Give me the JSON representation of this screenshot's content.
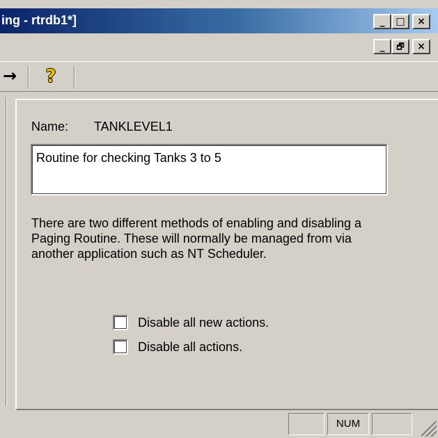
{
  "window": {
    "title": "ing - rtrdb1*]",
    "minimize_glyph": "_",
    "maximize_glyph": "□",
    "close_glyph": "×",
    "restore_glyph": "🗗"
  },
  "toolbar": {
    "arrow_icon": "→",
    "help_icon": "?"
  },
  "form": {
    "name_label": "Name:",
    "name_value": "TANKLEVEL1",
    "description": "Routine for checking Tanks 3 to 5",
    "info_text": "There are two different methods of enabling and disabling a Paging Routine. These will normally be managed from via another application such as NT Scheduler.",
    "checkbox_new_actions_label": "Disable all new actions.",
    "checkbox_new_actions_checked": false,
    "checkbox_all_actions_label": "Disable all actions.",
    "checkbox_all_actions_checked": false
  },
  "statusbar": {
    "num_indicator": "NUM"
  }
}
